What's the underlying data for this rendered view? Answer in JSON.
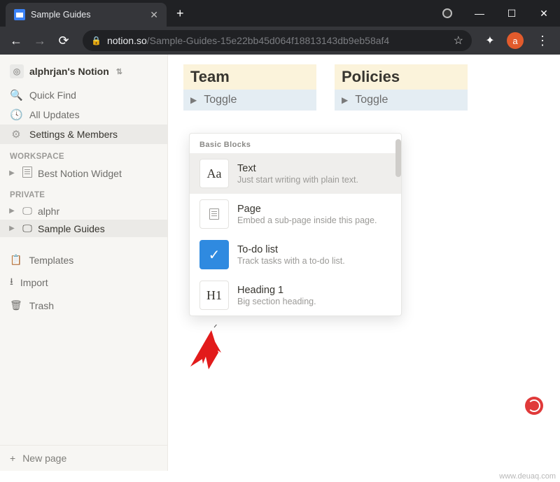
{
  "browser": {
    "tab_title": "Sample Guides",
    "url_host": "notion.so",
    "url_path": "/Sample-Guides-15e22bb45d064f18813143db9eb58af4",
    "avatar_letter": "a"
  },
  "sidebar": {
    "workspace_name": "alphrjan's Notion",
    "quick_find": "Quick Find",
    "all_updates": "All Updates",
    "settings": "Settings & Members",
    "section_workspace": "Workspace",
    "section_private": "Private",
    "workspace_pages": [
      {
        "label": "Best Notion Widget",
        "icon": "doc"
      }
    ],
    "private_pages": [
      {
        "label": "alphr",
        "icon": "screen"
      },
      {
        "label": "Sample Guides",
        "icon": "screen",
        "selected": true
      }
    ],
    "templates": "Templates",
    "import": "Import",
    "trash": "Trash",
    "new_page": "New page"
  },
  "main": {
    "columns": [
      {
        "heading": "Team",
        "toggle": "Toggle"
      },
      {
        "heading": "Policies",
        "toggle": "Toggle"
      }
    ]
  },
  "slash_menu": {
    "section": "Basic Blocks",
    "items": [
      {
        "icon": "Aa",
        "title": "Text",
        "desc": "Just start writing with plain text.",
        "selected": true
      },
      {
        "icon": "doc",
        "title": "Page",
        "desc": "Embed a sub-page inside this page."
      },
      {
        "icon": "check",
        "title": "To-do list",
        "desc": "Track tasks with a to-do list."
      },
      {
        "icon": "H1",
        "title": "Heading 1",
        "desc": "Big section heading."
      }
    ]
  },
  "watermark": "www.deuaq.com"
}
